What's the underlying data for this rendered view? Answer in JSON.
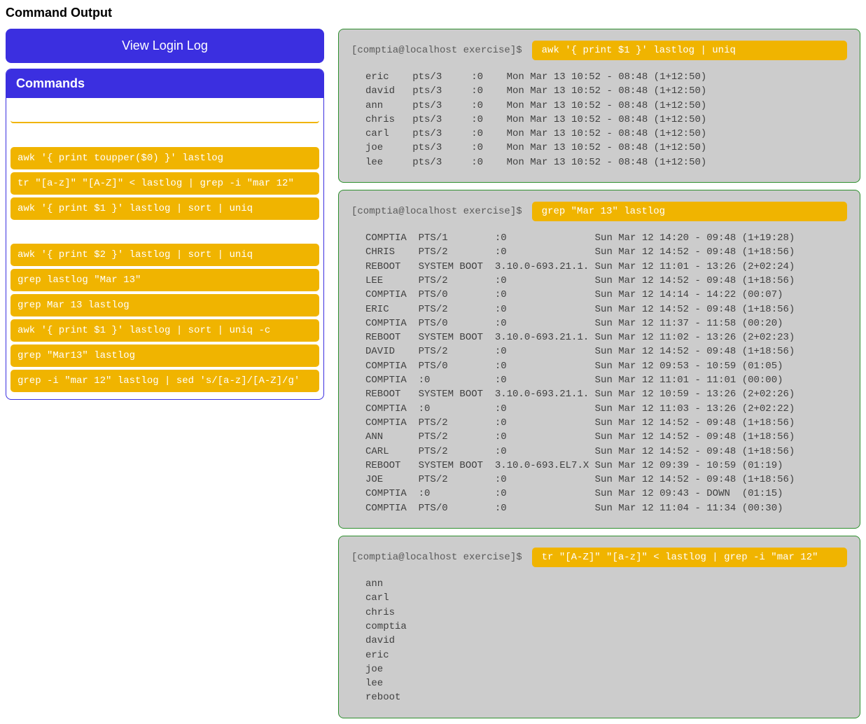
{
  "title": "Command Output",
  "view_login_label": "View Login Log",
  "commands_header": "Commands",
  "command_chips": [
    "awk '{ print toupper($0) }' lastlog",
    "tr \"[a-z]\" \"[A-Z]\" < lastlog | grep -i \"mar 12\"",
    "awk '{ print $1 }' lastlog | sort | uniq",
    "awk '{ print $2 }' lastlog | sort | uniq",
    "grep lastlog \"Mar 13\"",
    "grep Mar 13 lastlog",
    "awk '{ print $1 }' lastlog | sort | uniq -c",
    "grep \"Mar13\" lastlog",
    "grep -i \"mar 12\" lastlog | sed 's/[a-z]/[A-Z]/g'"
  ],
  "prompt": "[comptia@localhost exercise]$",
  "terminals": [
    {
      "command": "awk '{ print $1 }' lastlog | uniq",
      "output": "eric    pts/3     :0    Mon Mar 13 10:52 - 08:48 (1+12:50)\ndavid   pts/3     :0    Mon Mar 13 10:52 - 08:48 (1+12:50)\nann     pts/3     :0    Mon Mar 13 10:52 - 08:48 (1+12:50)\nchris   pts/3     :0    Mon Mar 13 10:52 - 08:48 (1+12:50)\ncarl    pts/3     :0    Mon Mar 13 10:52 - 08:48 (1+12:50)\njoe     pts/3     :0    Mon Mar 13 10:52 - 08:48 (1+12:50)\nlee     pts/3     :0    Mon Mar 13 10:52 - 08:48 (1+12:50)"
    },
    {
      "command": "grep \"Mar 13\" lastlog",
      "output": "COMPTIA  PTS/1        :0               Sun Mar 12 14:20 - 09:48 (1+19:28)\nCHRIS    PTS/2        :0               Sun Mar 12 14:52 - 09:48 (1+18:56)\nREBOOT   SYSTEM BOOT  3.10.0-693.21.1. Sun Mar 12 11:01 - 13:26 (2+02:24)\nLEE      PTS/2        :0               Sun Mar 12 14:52 - 09:48 (1+18:56)\nCOMPTIA  PTS/0        :0               Sun Mar 12 14:14 - 14:22 (00:07)\nERIC     PTS/2        :0               Sun Mar 12 14:52 - 09:48 (1+18:56)\nCOMPTIA  PTS/0        :0               Sun Mar 12 11:37 - 11:58 (00:20)\nREBOOT   SYSTEM BOOT  3.10.0-693.21.1. Sun Mar 12 11:02 - 13:26 (2+02:23)\nDAVID    PTS/2        :0               Sun Mar 12 14:52 - 09:48 (1+18:56)\nCOMPTIA  PTS/0        :0               Sun Mar 12 09:53 - 10:59 (01:05)\nCOMPTIA  :0           :0               Sun Mar 12 11:01 - 11:01 (00:00)\nREBOOT   SYSTEM BOOT  3.10.0-693.21.1. Sun Mar 12 10:59 - 13:26 (2+02:26)\nCOMPTIA  :0           :0               Sun Mar 12 11:03 - 13:26 (2+02:22)\nCOMPTIA  PTS/2        :0               Sun Mar 12 14:52 - 09:48 (1+18:56)\nANN      PTS/2        :0               Sun Mar 12 14:52 - 09:48 (1+18:56)\nCARL     PTS/2        :0               Sun Mar 12 14:52 - 09:48 (1+18:56)\nREBOOT   SYSTEM BOOT  3.10.0-693.EL7.X Sun Mar 12 09:39 - 10:59 (01:19)\nJOE      PTS/2        :0               Sun Mar 12 14:52 - 09:48 (1+18:56)\nCOMPTIA  :0           :0               Sun Mar 12 09:43 - DOWN  (01:15)\nCOMPTIA  PTS/0        :0               Sun Mar 12 11:04 - 11:34 (00:30)"
    },
    {
      "command": "tr \"[A-Z]\" \"[a-z]\" < lastlog | grep -i \"mar 12\"",
      "output": "ann\ncarl\nchris\ncomptia\ndavid\neric\njoe\nlee\nreboot"
    }
  ]
}
